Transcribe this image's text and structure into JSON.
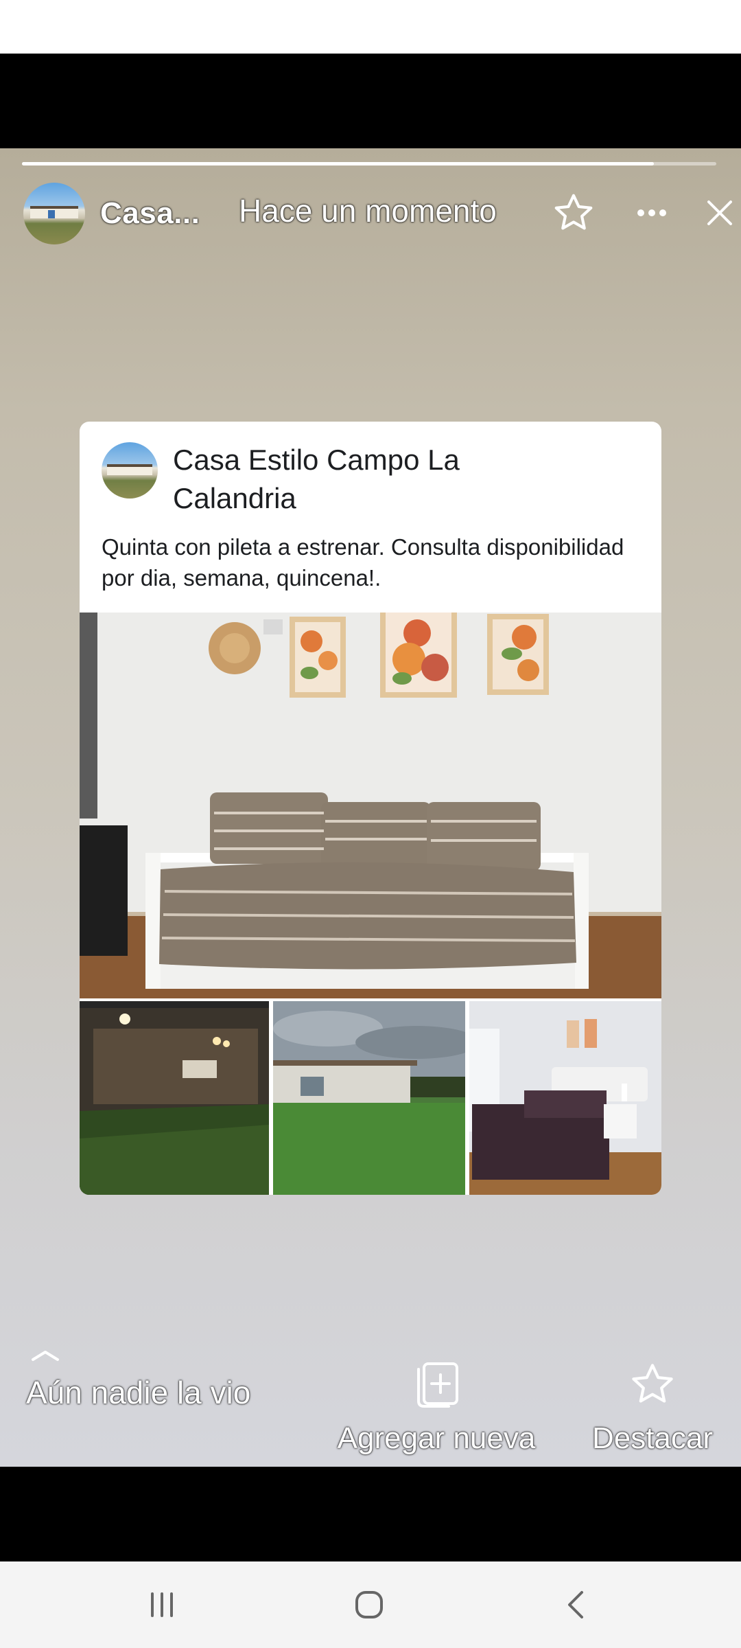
{
  "story": {
    "page_name_short": "Casa...",
    "timestamp": "Hace un momento",
    "progress": 0.91,
    "icons": {
      "favorite": "star-outline-icon",
      "more": "more-horizontal-icon",
      "close": "close-icon"
    }
  },
  "post": {
    "page_name": "Casa Estilo Campo La Calandria",
    "text": "Quinta con pileta a estrenar. Consulta disponibilidad por dia, semana, quincena!.",
    "photos": {
      "main": "living-room-daybed-photo",
      "thumbs": [
        "night-porch-photo",
        "house-exterior-lawn-photo",
        "bedroom-photo"
      ]
    }
  },
  "bottom": {
    "viewers_text": "Aún nadie la vio",
    "add_new_label": "Agregar nueva",
    "feature_label": "Destacar"
  },
  "navbar": {
    "icons": [
      "recent-apps-icon",
      "home-icon",
      "back-icon"
    ]
  }
}
